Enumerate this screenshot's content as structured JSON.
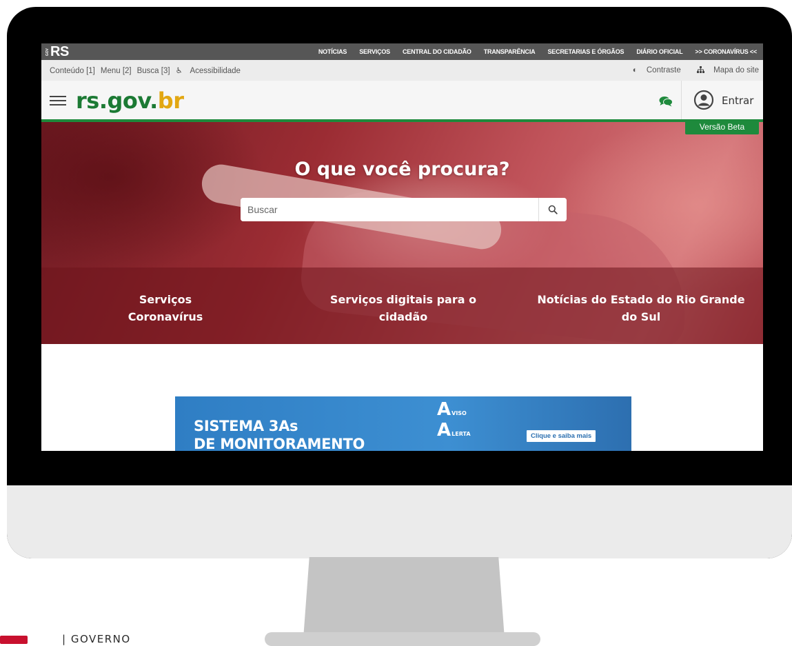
{
  "topbar": {
    "logo": "RS",
    "logo_small": "GOV",
    "nav": [
      "NOTÍCIAS",
      "SERVIÇOS",
      "CENTRAL DO CIDADÃO",
      "TRANSPARÊNCIA",
      "SECRETARIAS E ÓRGÃOS",
      "DIÁRIO OFICIAL",
      ">> CORONAVÍRUS <<"
    ]
  },
  "accessibility": {
    "conteudo": "Conteúdo [1]",
    "menu": "Menu [2]",
    "busca": "Busca [3]",
    "acessibilidade": "Acessibilidade",
    "contraste": "Contraste",
    "mapa": "Mapa do site"
  },
  "header": {
    "logo_rs": "rs",
    "logo_dot": ".gov.",
    "logo_br": "br",
    "login": "Entrar",
    "beta": "Versão Beta"
  },
  "hero": {
    "title": "O que você procura?",
    "search_placeholder": "Buscar",
    "links": [
      "Serviços Coronavírus",
      "Serviços digitais para o cidadão",
      "Notícias do Estado do Rio Grande do Sul"
    ]
  },
  "banner": {
    "title_line1": "SISTEMA 3As",
    "title_line2": "DE MONITORAMENTO",
    "a1": "VISO",
    "a2": "LERTA",
    "cta": "Clique e saiba mais"
  },
  "footer": {
    "governo": "| GOVERNO"
  },
  "colors": {
    "green": "#1e8a3c",
    "yellow": "#e2a712",
    "hero_red": "#9b2c33"
  }
}
